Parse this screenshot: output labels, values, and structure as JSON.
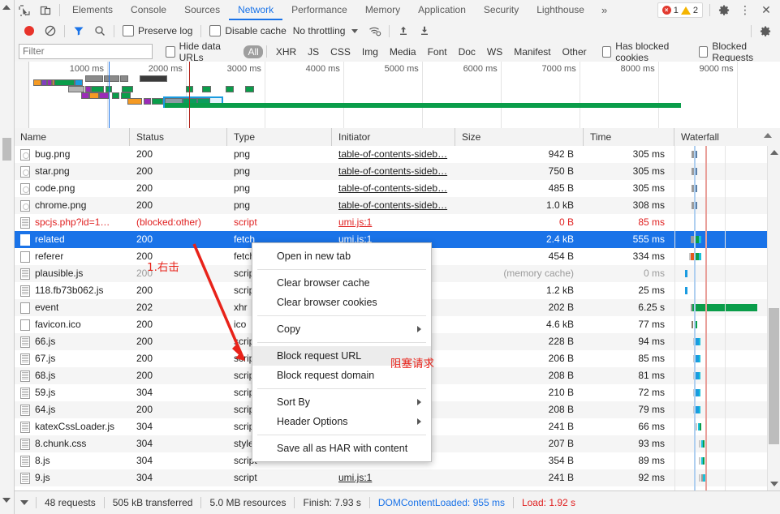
{
  "tabstrip": {
    "icons": [
      "inspect-element-icon",
      "device-toolbar-icon"
    ],
    "tabs": [
      {
        "label": "Elements",
        "active": false
      },
      {
        "label": "Console",
        "active": false
      },
      {
        "label": "Sources",
        "active": false
      },
      {
        "label": "Network",
        "active": true
      },
      {
        "label": "Performance",
        "active": false
      },
      {
        "label": "Memory",
        "active": false
      },
      {
        "label": "Application",
        "active": false
      },
      {
        "label": "Security",
        "active": false
      },
      {
        "label": "Lighthouse",
        "active": false
      }
    ],
    "more_label": "»",
    "error_count": "1",
    "warning_count": "2",
    "settings_label": "⚙",
    "kebab_label": "⋮",
    "close_label": "✕"
  },
  "toolbar": {
    "record_title": "record-button",
    "clear_title": "clear-button",
    "filter_title": "filter-button",
    "search_title": "search-button",
    "preserve_log": "Preserve log",
    "disable_cache": "Disable cache",
    "throttling": "No throttling",
    "wifi_title": "network-conditions-icon",
    "import_title": "import-har-icon",
    "export_title": "export-har-icon",
    "settings_title": "network-settings-icon"
  },
  "filterbar": {
    "placeholder": "Filter",
    "value": "",
    "hide_data_urls": "Hide data URLs",
    "types": [
      "All",
      "XHR",
      "JS",
      "CSS",
      "Img",
      "Media",
      "Font",
      "Doc",
      "WS",
      "Manifest",
      "Other"
    ],
    "active_type": "All",
    "has_blocked_cookies": "Has blocked cookies",
    "blocked_requests": "Blocked Requests"
  },
  "overview": {
    "ticks": [
      "1000 ms",
      "2000 ms",
      "3000 ms",
      "4000 ms",
      "5000 ms",
      "6000 ms",
      "7000 ms",
      "8000 ms",
      "9000 ms"
    ],
    "dom_content_loaded_color": "#1a73e8",
    "load_color": "#b3261e"
  },
  "table": {
    "columns": [
      "Name",
      "Status",
      "Type",
      "Initiator",
      "Size",
      "Time",
      "Waterfall"
    ],
    "sorted_column": "Waterfall",
    "rows": [
      {
        "name": "bug.png",
        "icon": "image-file-icon",
        "status": "200",
        "type": "png",
        "initiator": "table-of-contents-sideb…",
        "size": "942 B",
        "time": "305 ms",
        "state": "normal"
      },
      {
        "name": "star.png",
        "icon": "image-file-icon",
        "status": "200",
        "type": "png",
        "initiator": "table-of-contents-sideb…",
        "size": "750 B",
        "time": "305 ms",
        "state": "normal"
      },
      {
        "name": "code.png",
        "icon": "image-file-icon",
        "status": "200",
        "type": "png",
        "initiator": "table-of-contents-sideb…",
        "size": "485 B",
        "time": "305 ms",
        "state": "normal"
      },
      {
        "name": "chrome.png",
        "icon": "image-file-icon",
        "status": "200",
        "type": "png",
        "initiator": "table-of-contents-sideb…",
        "size": "1.0 kB",
        "time": "308 ms",
        "state": "normal"
      },
      {
        "name": "spcjs.php?id=1…",
        "icon": "script-file-icon",
        "status": "(blocked:other)",
        "type": "script",
        "initiator": "umi.js:1",
        "size": "0 B",
        "time": "85 ms",
        "state": "error"
      },
      {
        "name": "related",
        "icon": "plain-file-icon",
        "status": "200",
        "type": "fetch",
        "initiator": "umi.js:1",
        "size": "2.4 kB",
        "time": "555 ms",
        "state": "selected"
      },
      {
        "name": "referer",
        "icon": "plain-file-icon",
        "status": "200",
        "type": "fetch",
        "initiator": "",
        "size": "454 B",
        "time": "334 ms",
        "state": "normal"
      },
      {
        "name": "plausible.js",
        "icon": "script-file-icon",
        "status": "200",
        "type": "script",
        "initiator": "",
        "size": "(memory cache)",
        "time": "0 ms",
        "state": "cached"
      },
      {
        "name": "118.fb73b062.js",
        "icon": "script-file-icon",
        "status": "200",
        "type": "script",
        "initiator": "",
        "size": "1.2 kB",
        "time": "25 ms",
        "state": "normal"
      },
      {
        "name": "event",
        "icon": "plain-file-icon",
        "status": "202",
        "type": "xhr",
        "initiator": "",
        "size": "202 B",
        "time": "6.25 s",
        "state": "normal"
      },
      {
        "name": "favicon.ico",
        "icon": "plain-file-icon",
        "status": "200",
        "type": "ico",
        "initiator": "",
        "size": "4.6 kB",
        "time": "77 ms",
        "state": "normal"
      },
      {
        "name": "66.js",
        "icon": "script-file-icon",
        "status": "200",
        "type": "script",
        "initiator": "",
        "size": "228 B",
        "time": "94 ms",
        "state": "normal"
      },
      {
        "name": "67.js",
        "icon": "script-file-icon",
        "status": "200",
        "type": "script",
        "initiator": "",
        "size": "206 B",
        "time": "85 ms",
        "state": "normal"
      },
      {
        "name": "68.js",
        "icon": "script-file-icon",
        "status": "200",
        "type": "script",
        "initiator": "",
        "size": "208 B",
        "time": "81 ms",
        "state": "normal"
      },
      {
        "name": "59.js",
        "icon": "script-file-icon",
        "status": "304",
        "type": "script",
        "initiator": "",
        "size": "210 B",
        "time": "72 ms",
        "state": "normal"
      },
      {
        "name": "64.js",
        "icon": "script-file-icon",
        "status": "200",
        "type": "script",
        "initiator": "",
        "size": "208 B",
        "time": "79 ms",
        "state": "normal"
      },
      {
        "name": "katexCssLoader.js",
        "icon": "script-file-icon",
        "status": "304",
        "type": "script",
        "initiator": "",
        "size": "241 B",
        "time": "66 ms",
        "state": "normal"
      },
      {
        "name": "8.chunk.css",
        "icon": "script-file-icon",
        "status": "304",
        "type": "styles",
        "initiator": "",
        "size": "207 B",
        "time": "93 ms",
        "state": "normal"
      },
      {
        "name": "8.js",
        "icon": "script-file-icon",
        "status": "304",
        "type": "script",
        "initiator": "",
        "size": "354 B",
        "time": "89 ms",
        "state": "normal"
      },
      {
        "name": "9.js",
        "icon": "script-file-icon",
        "status": "304",
        "type": "script",
        "initiator": "umi.js:1",
        "size": "241 B",
        "time": "92 ms",
        "state": "normal"
      }
    ]
  },
  "context_menu": {
    "items": [
      {
        "label": "Open in new tab",
        "submenu": false,
        "highlighted": false
      },
      {
        "separator": true
      },
      {
        "label": "Clear browser cache",
        "submenu": false,
        "highlighted": false
      },
      {
        "label": "Clear browser cookies",
        "submenu": false,
        "highlighted": false
      },
      {
        "separator": true
      },
      {
        "label": "Copy",
        "submenu": true,
        "highlighted": false
      },
      {
        "separator": true
      },
      {
        "label": "Block request URL",
        "submenu": false,
        "highlighted": true
      },
      {
        "label": "Block request domain",
        "submenu": false,
        "highlighted": false
      },
      {
        "separator": true
      },
      {
        "label": "Sort By",
        "submenu": true,
        "highlighted": false
      },
      {
        "label": "Header Options",
        "submenu": true,
        "highlighted": false
      },
      {
        "separator": true
      },
      {
        "label": "Save all as HAR with content",
        "submenu": false,
        "highlighted": false
      }
    ]
  },
  "annotations": {
    "step1": "1.右击",
    "step2": "阻塞请求",
    "color": "#e8231a"
  },
  "statusbar": {
    "requests": "48 requests",
    "transferred": "505 kB transferred",
    "resources": "5.0 MB resources",
    "finish": "Finish: 7.93 s",
    "dom_content_loaded": "DOMContentLoaded: 955 ms",
    "load": "Load: 1.92 s"
  }
}
